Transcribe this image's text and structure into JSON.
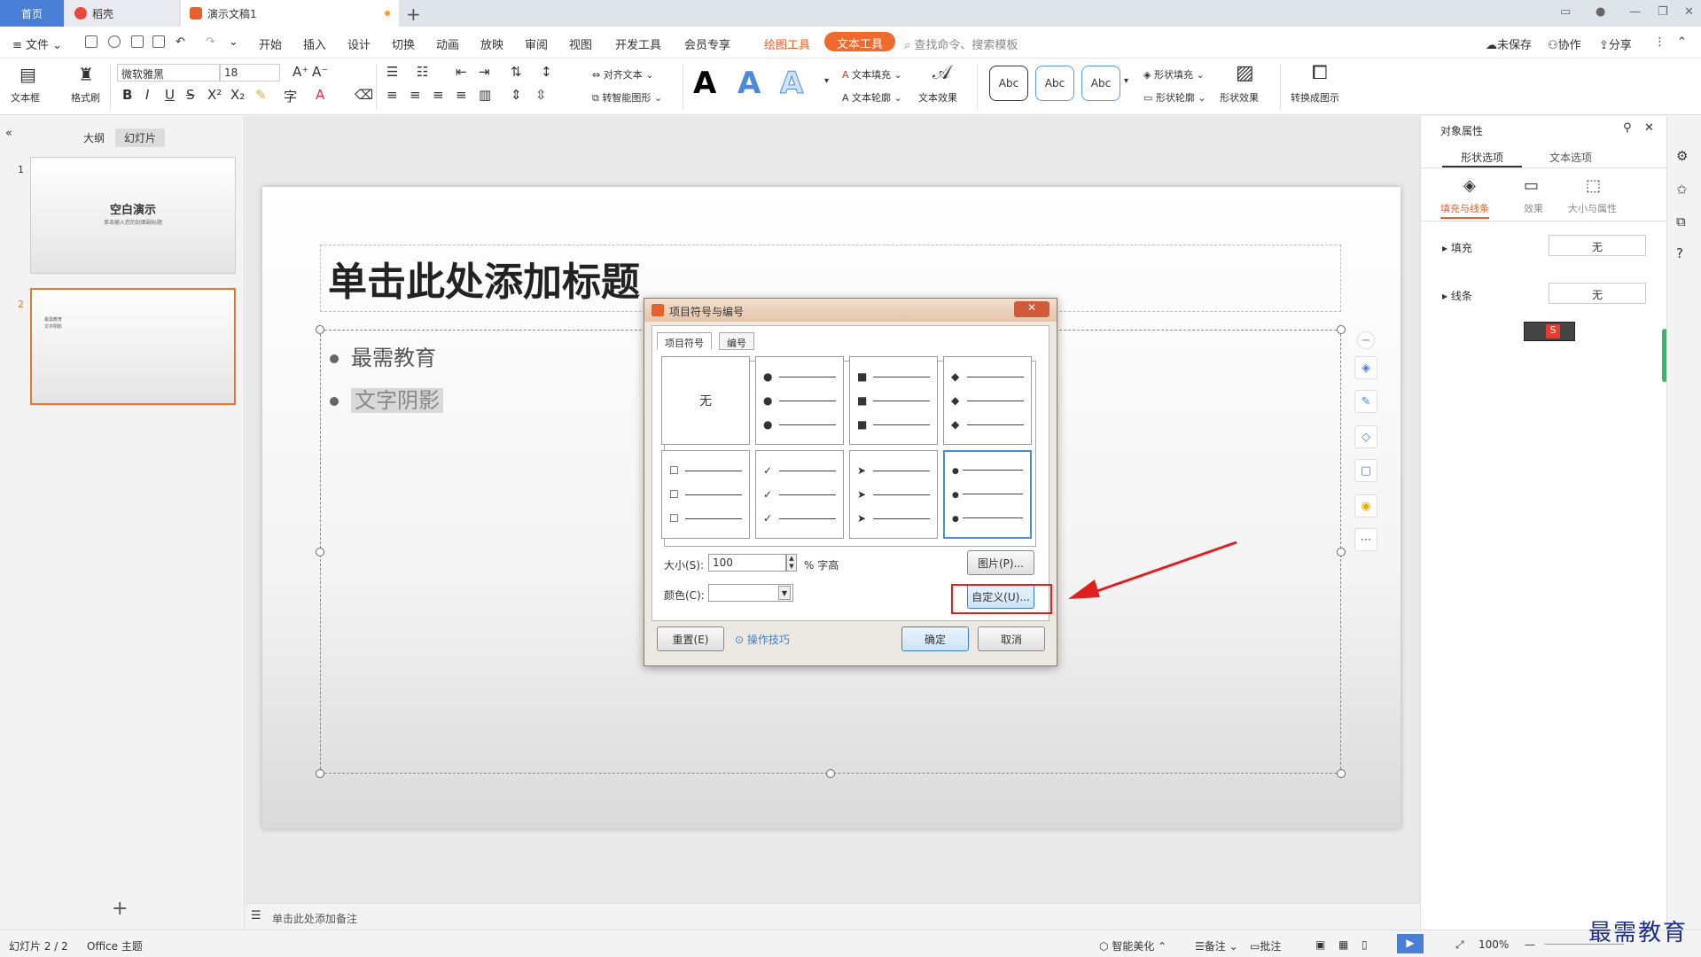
{
  "tabs": {
    "home": "首页",
    "daoke": "稻壳",
    "doc": "演示文稿1"
  },
  "menu": {
    "file": "文件",
    "items": [
      "开始",
      "插入",
      "设计",
      "切换",
      "动画",
      "放映",
      "审阅",
      "视图",
      "开发工具",
      "会员专享"
    ],
    "draw_tools": "绘图工具",
    "text_tools": "文本工具",
    "search": "查找命令、搜索模板",
    "unsaved": "未保存",
    "collab": "协作",
    "share": "分享"
  },
  "ribbon": {
    "textbox": "文本框",
    "format_painter": "格式刷",
    "font_name": "微软雅黑",
    "font_size": "18",
    "align_text": "对齐文本",
    "smart_shape": "转智能图形",
    "text_fill": "文本填充",
    "text_outline": "文本轮廓",
    "text_effect": "文本效果",
    "abc1": "Abc",
    "abc2": "Abc",
    "abc3": "Abc",
    "shape_fill": "形状填充",
    "shape_outline": "形状轮廓",
    "shape_effect": "形状效果",
    "convert": "转换成图示"
  },
  "leftpanel": {
    "tab_outline": "大纲",
    "tab_slides": "幻灯片",
    "slide1_num": "1",
    "slide1_title": "空白演示",
    "slide1_sub": "单击输入您的封面副标题",
    "slide2_num": "2",
    "slide2_l1": "最需教育",
    "slide2_l2": "文字阴影"
  },
  "slide": {
    "title": "单击此处添加标题",
    "bullet1": "最需教育",
    "bullet2": "文字阴影"
  },
  "notes": "单击此处添加备注",
  "rightpanel": {
    "title": "对象属性",
    "tab_shape": "形状选项",
    "tab_text": "文本选项",
    "fill_line": "填充与线条",
    "effect": "效果",
    "size_prop": "大小与属性",
    "fill": "填充",
    "fill_val": "无",
    "line": "线条",
    "line_val": "无"
  },
  "dialog": {
    "title": "项目符号与编号",
    "tab_bullet": "项目符号",
    "tab_number": "编号",
    "none": "无",
    "size_label": "大小(S):",
    "size_value": "100",
    "size_unit": "% 字高",
    "color_label": "颜色(C):",
    "picture_btn": "图片(P)...",
    "custom_btn": "自定义(U)...",
    "reset_btn": "重置(E)",
    "tips": "操作技巧",
    "ok_btn": "确定",
    "cancel_btn": "取消"
  },
  "statusbar": {
    "slide_count": "幻灯片 2 / 2",
    "theme": "Office 主题",
    "beautify": "智能美化",
    "notes": "备注",
    "comments": "批注",
    "zoom": "100%"
  },
  "watermark": "最需教育"
}
